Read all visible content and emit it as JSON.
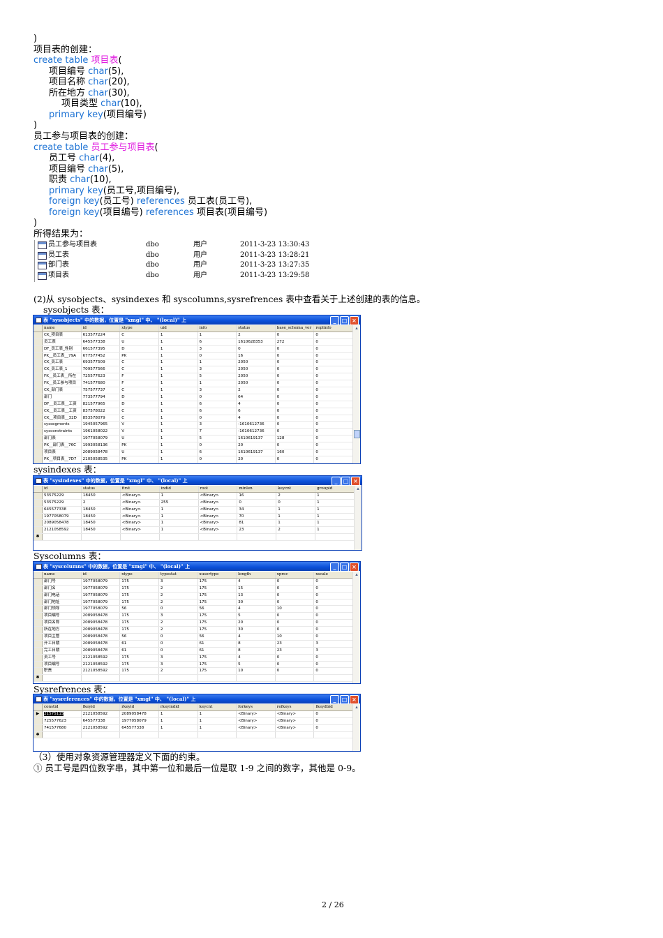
{
  "code_lines": [
    [
      [
        ")",
        "t"
      ]
    ],
    [
      [
        "项目表的创建：",
        "t"
      ]
    ],
    [
      [
        "create table ",
        "kw"
      ],
      [
        "项目表",
        "tn"
      ],
      [
        "(",
        "t"
      ]
    ],
    [
      [
        "项目编号 ",
        "t"
      ],
      [
        "char",
        "kw"
      ],
      [
        "(5),",
        "t"
      ]
    ],
    [
      [
        "项目名称 ",
        "t"
      ],
      [
        "char",
        "kw"
      ],
      [
        "(20),",
        "t"
      ]
    ],
    [
      [
        "所在地方 ",
        "t"
      ],
      [
        "char",
        "kw"
      ],
      [
        "(30),",
        "t"
      ]
    ],
    [
      [
        "项目类型 ",
        "t"
      ],
      [
        "char",
        "kw"
      ],
      [
        "(10),",
        "t"
      ]
    ],
    [
      [
        "primary key",
        "kw"
      ],
      [
        "(项目编号)",
        "t"
      ]
    ],
    [
      [
        ")",
        "t"
      ]
    ],
    [
      [
        "员工参与项目表的创建：",
        "t"
      ]
    ],
    [
      [
        "create table ",
        "kw"
      ],
      [
        "员工参与项目表",
        "tn"
      ],
      [
        "(",
        "t"
      ]
    ],
    [
      [
        "员工号 ",
        "t"
      ],
      [
        "char",
        "kw"
      ],
      [
        "(4),",
        "t"
      ]
    ],
    [
      [
        "项目编号 ",
        "t"
      ],
      [
        "char",
        "kw"
      ],
      [
        "(5),",
        "t"
      ]
    ],
    [
      [
        "职责 ",
        "t"
      ],
      [
        "char",
        "kw"
      ],
      [
        "(10),",
        "t"
      ]
    ],
    [
      [
        "primary key",
        "kw"
      ],
      [
        "(员工号,项目编号),",
        "t"
      ]
    ],
    [
      [
        "foreign key",
        "kw"
      ],
      [
        "(员工号) ",
        "t"
      ],
      [
        "references",
        "kw"
      ],
      [
        " 员工表(员工号),",
        "t"
      ]
    ],
    [
      [
        "foreign key",
        "kw"
      ],
      [
        "(项目编号) ",
        "t"
      ],
      [
        "references",
        "kw"
      ],
      [
        " 项目表(项目编号)",
        "t"
      ]
    ],
    [
      [
        ")",
        "t"
      ]
    ],
    [
      [
        "所得结果为：",
        "t"
      ]
    ]
  ],
  "result_list": [
    {
      "name": "员工参与项目表",
      "owner": "dbo",
      "type": "用户",
      "created": "2011-3-23 13:30:43"
    },
    {
      "name": "员工表",
      "owner": "dbo",
      "type": "用户",
      "created": "2011-3-23 13:28:21"
    },
    {
      "name": "部门表",
      "owner": "dbo",
      "type": "用户",
      "created": "2011-3-23 13:27:35"
    },
    {
      "name": "项目表",
      "owner": "dbo",
      "type": "用户",
      "created": "2011-3-23 13:29:58"
    }
  ],
  "section2_text": "(2)从 sysobjects、sysindexes 和 syscolumns,sysrefrences 表中查看关于上述创建的表的信息。",
  "tables": [
    {
      "label": "sysobjects 表：",
      "title": "表 \"sysobjects\" 中的数据，位置是 \"xmgl\" 中、 \"(local)\" 上",
      "columns": [
        "name",
        "id",
        "xtype",
        "uid",
        "info",
        "status",
        "base_schema_ver",
        "replinfo"
      ],
      "rows": [
        [
          "CK_项目表",
          "613577224",
          "C",
          "1",
          "1",
          "2",
          "0",
          "0"
        ],
        [
          "员工表",
          "645577338",
          "U",
          "1",
          "6",
          "1610628353",
          "272",
          "0"
        ],
        [
          "DF_员工表_性别",
          "661577395",
          "D",
          "1",
          "3",
          "0",
          "0",
          "0"
        ],
        [
          "PK__员工表__79A",
          "677577452",
          "PK",
          "1",
          "0",
          "16",
          "0",
          "0"
        ],
        [
          "CK_员工表",
          "693577509",
          "C",
          "1",
          "1",
          "2050",
          "0",
          "0"
        ],
        [
          "CK_员工表_1",
          "709577566",
          "C",
          "1",
          "3",
          "2050",
          "0",
          "0"
        ],
        [
          "FK__员工表__所在",
          "725577623",
          "F",
          "1",
          "5",
          "2050",
          "0",
          "0"
        ],
        [
          "FK__员工参与项目",
          "741577680",
          "F",
          "1",
          "1",
          "2050",
          "0",
          "0"
        ],
        [
          "CK_部门表",
          "757577737",
          "C",
          "1",
          "3",
          "2",
          "0",
          "0"
        ],
        [
          "部门",
          "773577794",
          "D",
          "1",
          "0",
          "64",
          "0",
          "0"
        ],
        [
          "DF__员工表__工资",
          "821577965",
          "D",
          "1",
          "6",
          "4",
          "0",
          "0"
        ],
        [
          "CK__员工表__工资",
          "837578022",
          "C",
          "1",
          "6",
          "6",
          "0",
          "0"
        ],
        [
          "CK__项目表__32D",
          "853578079",
          "C",
          "1",
          "0",
          "4",
          "0",
          "0"
        ],
        [
          "syssegments",
          "1945057965",
          "V",
          "1",
          "3",
          "-1610612736",
          "0",
          "0"
        ],
        [
          "sysconstraints",
          "1961058022",
          "V",
          "1",
          "7",
          "-1610612736",
          "0",
          "0"
        ],
        [
          "部门表",
          "1977058079",
          "U",
          "1",
          "5",
          "1610619137",
          "128",
          "0"
        ],
        [
          "PK__部门表__76C",
          "1993058136",
          "PK",
          "1",
          "0",
          "20",
          "0",
          "0"
        ],
        [
          "项目表",
          "2089058478",
          "U",
          "1",
          "6",
          "1610619137",
          "160",
          "0"
        ],
        [
          "PK__项目表__7D7",
          "2105058535",
          "PK",
          "1",
          "0",
          "20",
          "0",
          "0"
        ],
        [
          "员工参与项目表",
          "2121058592",
          "U",
          "1",
          "3",
          "1610614017",
          "32",
          "0"
        ],
        [
          "PK__员工参与项目",
          "2137058649",
          "PK",
          "1",
          "0",
          "20",
          "0",
          "0"
        ]
      ]
    },
    {
      "label": "sysindexes 表：",
      "title": "表 \"sysindexes\" 中的数据，位置是 \"xmgl\" 中、 \"(local)\" 上",
      "columns": [
        "id",
        "status",
        "first",
        "indid",
        "root",
        "minlen",
        "keycnt",
        "groupid"
      ],
      "rows": [
        [
          "53575229",
          "18450",
          "<Binary>",
          "1",
          "<Binary>",
          "16",
          "2",
          "1"
        ],
        [
          "53575229",
          "2",
          "<Binary>",
          "255",
          "<Binary>",
          "0",
          "0",
          "1"
        ],
        [
          "645577338",
          "18450",
          "<Binary>",
          "1",
          "<Binary>",
          "34",
          "1",
          "1"
        ],
        [
          "1977058079",
          "18450",
          "<Binary>",
          "1",
          "<Binary>",
          "70",
          "1",
          "1"
        ],
        [
          "2089058478",
          "18450",
          "<Binary>",
          "1",
          "<Binary>",
          "81",
          "1",
          "1"
        ],
        [
          "2121058592",
          "18450",
          "<Binary>",
          "1",
          "<Binary>",
          "23",
          "2",
          "1"
        ]
      ]
    },
    {
      "label": "Syscolumns 表：",
      "title": "表 \"syscolumns\" 中的数据，位置是 \"xmgl\" 中、 \"(local)\" 上",
      "columns": [
        "name",
        "id",
        "xtype",
        "typestat",
        "xusertype",
        "length",
        "xprec",
        "xscale"
      ],
      "rows": [
        [
          "部门号",
          "1977058079",
          "175",
          "3",
          "175",
          "4",
          "0",
          "0"
        ],
        [
          "部门名",
          "1977058079",
          "175",
          "2",
          "175",
          "15",
          "0",
          "0"
        ],
        [
          "部门电话",
          "1977058079",
          "175",
          "2",
          "175",
          "13",
          "0",
          "0"
        ],
        [
          "部门地址",
          "1977058079",
          "175",
          "2",
          "175",
          "30",
          "0",
          "0"
        ],
        [
          "部门领导",
          "1977058079",
          "56",
          "0",
          "56",
          "4",
          "10",
          "0"
        ],
        [
          "项目编号",
          "2089058478",
          "175",
          "3",
          "175",
          "5",
          "0",
          "0"
        ],
        [
          "项目名称",
          "2089058478",
          "175",
          "2",
          "175",
          "20",
          "0",
          "0"
        ],
        [
          "所在地方",
          "2089058478",
          "175",
          "2",
          "175",
          "30",
          "0",
          "0"
        ],
        [
          "项目主管",
          "2089058478",
          "56",
          "0",
          "56",
          "4",
          "10",
          "0"
        ],
        [
          "开工日期",
          "2089058478",
          "61",
          "0",
          "61",
          "8",
          "23",
          "3"
        ],
        [
          "完工日期",
          "2089058478",
          "61",
          "0",
          "61",
          "8",
          "23",
          "3"
        ],
        [
          "员工号",
          "2121058592",
          "175",
          "3",
          "175",
          "4",
          "0",
          "0"
        ],
        [
          "项目编号",
          "2121058592",
          "175",
          "3",
          "175",
          "5",
          "0",
          "0"
        ],
        [
          "职责",
          "2121058592",
          "175",
          "2",
          "175",
          "10",
          "0",
          "0"
        ]
      ]
    },
    {
      "label": "Sysrefrences 表：",
      "title": "表 \"sysreferences\" 中的数据，位置是 \"xmgl\" 中、 \"(local)\" 上",
      "columns": [
        "constid",
        "fkeyid",
        "rkeyid",
        "rkeyindid",
        "keycnt",
        "forkeys",
        "refkeys",
        "fkeydbid"
      ],
      "rows": [
        [
          "21575115",
          "2121058592",
          "2089058478",
          "1",
          "1",
          "<Binary>",
          "<Binary>",
          "0"
        ],
        [
          "725577623",
          "645577338",
          "1977058079",
          "1",
          "1",
          "<Binary>",
          "<Binary>",
          "0"
        ],
        [
          "741577680",
          "2121058592",
          "645577338",
          "1",
          "1",
          "<Binary>",
          "<Binary>",
          "0"
        ]
      ]
    }
  ],
  "section3_text": "（3）使用对象资源管理器定义下面的约束。",
  "constraint_1": "① 员工号是四位数字串，其中第一位和最后一位是取 1-9 之间的数字，其他是 0-9。",
  "page_number": "2 / 26",
  "colors": {
    "keyword": "#1e73d4",
    "table_name": "#e01ee0",
    "titlebar": "#0a4fd8"
  }
}
